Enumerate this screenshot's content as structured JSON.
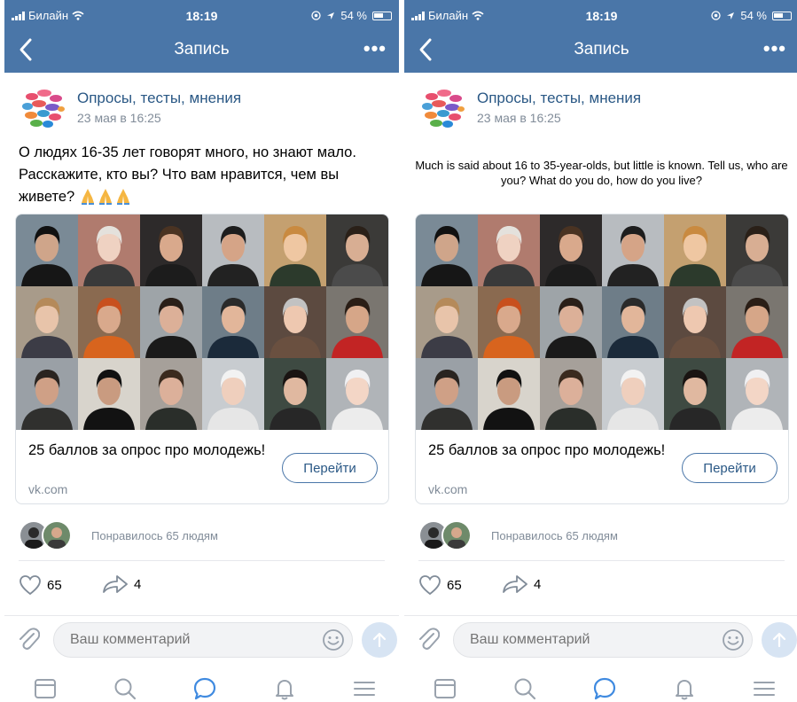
{
  "status": {
    "carrier": "Билайн",
    "time": "18:19",
    "battery": "54 %"
  },
  "nav": {
    "title": "Запись",
    "more": "•••"
  },
  "post": {
    "group_name": "Опросы, тесты, мнения",
    "date": "23 мая в 16:25",
    "text": "О людях 16-35 лет говорят много, но знают мало. Расскажите, кто вы? Что вам нравится, чем вы живете?",
    "text_translation": "Much is said about 16 to 35-year-olds, but little is known. Tell us, who are you? What do you do, how do you live?"
  },
  "card": {
    "title": "25 баллов за опрос про молодежь!",
    "domain": "vk.com",
    "button": "Перейти"
  },
  "likes": {
    "liked_text": "Понравилось 65 людям",
    "like_count": "65",
    "share_count": "4"
  },
  "comment": {
    "placeholder": "Ваш комментарий"
  },
  "tabs": [
    "news-tab",
    "search-tab",
    "messages-tab",
    "notifications-tab",
    "menu-tab"
  ],
  "colors": {
    "header": "#4a76a8",
    "link": "#2a5885",
    "secondary_text": "#818c99",
    "active_tab": "#3f8ae0",
    "inactive_tab": "#99a2ad"
  },
  "photo_tiles": [
    {
      "bg": "#7a8a96",
      "hair": "#111111",
      "skin": "#cfa58a",
      "cloth": "#161616"
    },
    {
      "bg": "#b07b6e",
      "hair": "#e4e1dc",
      "skin": "#efd2c2",
      "cloth": "#3a3a3a"
    },
    {
      "bg": "#2d2a2a",
      "hair": "#4a3322",
      "skin": "#d9a98c",
      "cloth": "#1c1c1c"
    },
    {
      "bg": "#b8bcc0",
      "hair": "#1d1d1d",
      "skin": "#d5a487",
      "cloth": "#222222"
    },
    {
      "bg": "#c4a070",
      "hair": "#c98a40",
      "skin": "#efc7a2",
      "cloth": "#2c3a2c"
    },
    {
      "bg": "#3b3a38",
      "hair": "#2a2018",
      "skin": "#d8ae93",
      "cloth": "#4b4b4b"
    },
    {
      "bg": "#a89b8a",
      "hair": "#b58a5a",
      "skin": "#e8c4aa",
      "cloth": "#3c3c46"
    },
    {
      "bg": "#8a6a50",
      "hair": "#c8501e",
      "skin": "#d9a98c",
      "cloth": "#d8641e"
    },
    {
      "bg": "#9ea4a8",
      "hair": "#2a1f18",
      "skin": "#dcb098",
      "cloth": "#1a1a1a"
    },
    {
      "bg": "#6e7d88",
      "hair": "#2a2a2a",
      "skin": "#e2b69a",
      "cloth": "#1b2a3a"
    },
    {
      "bg": "#5c4a40",
      "hair": "#c2c2c2",
      "skin": "#eec8b0",
      "cloth": "#6a5040"
    },
    {
      "bg": "#7a7670",
      "hair": "#2a1e16",
      "skin": "#d6a688",
      "cloth": "#c22424"
    },
    {
      "bg": "#9aa0a6",
      "hair": "#2a2420",
      "skin": "#cfa086",
      "cloth": "#30302e"
    },
    {
      "bg": "#d8d4cc",
      "hair": "#111111",
      "skin": "#c99b80",
      "cloth": "#121212"
    },
    {
      "bg": "#a6a09a",
      "hair": "#3a2a1e",
      "skin": "#dcb09a",
      "cloth": "#2a2e2a"
    },
    {
      "bg": "#c8ccd0",
      "hair": "#f2f2f2",
      "skin": "#efcfbd",
      "cloth": "#e6e6e6"
    },
    {
      "bg": "#3e4a42",
      "hair": "#1a1412",
      "skin": "#e0b8a0",
      "cloth": "#272727"
    },
    {
      "bg": "#b0b4b8",
      "hair": "#f0f0f2",
      "skin": "#f3d6c6",
      "cloth": "#ececec"
    }
  ]
}
